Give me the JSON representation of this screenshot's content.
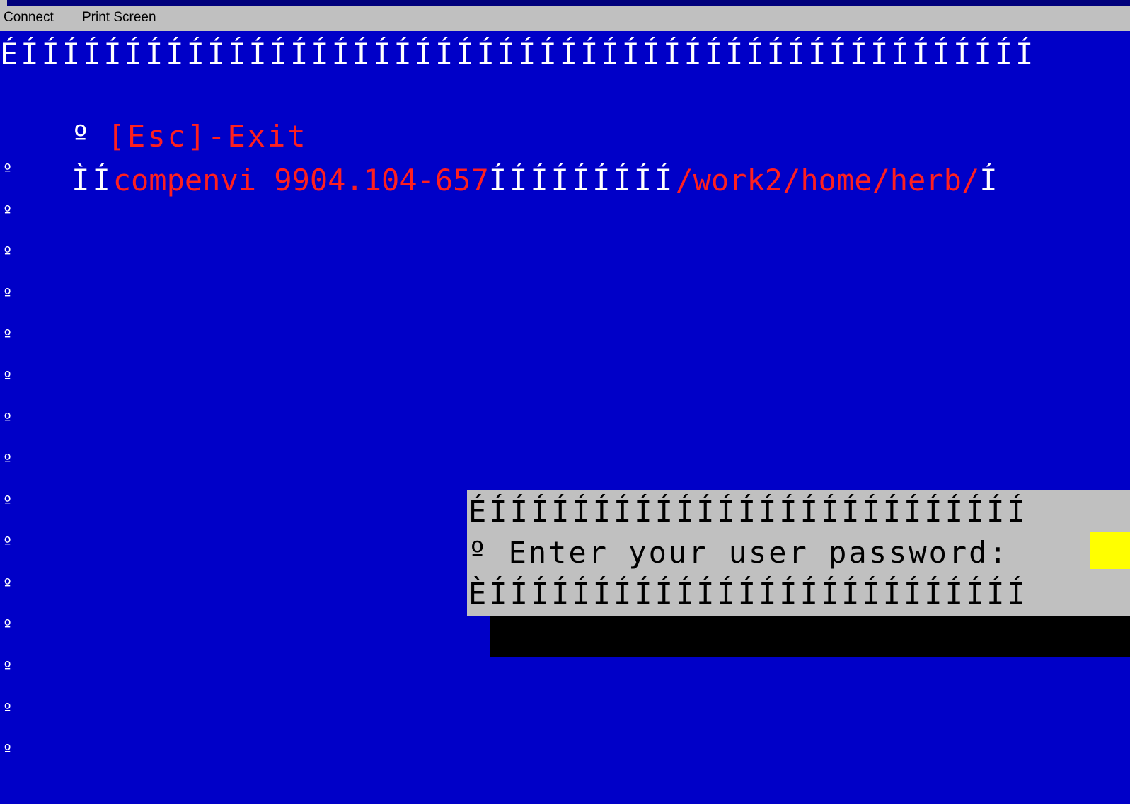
{
  "menu": {
    "connect": "Connect",
    "print_screen": "Print Screen"
  },
  "terminal": {
    "top_border": "ÉÍÍÍÍÍÍÍÍÍÍÍÍÍÍÍÍÍÍÍÍÍÍÍÍÍÍÍÍÍÍÍÍÍÍÍÍÍÍÍÍÍÍÍÍÍÍÍÍÍ",
    "esc_row": {
      "left_glyph": "º",
      "label": "[Esc]-Exit"
    },
    "status_row": {
      "lead": "ÌÍ",
      "version": "compenvi 9904.104-657",
      "fill": "ÍÍÍÍÍÍÍÍÍ",
      "path": "/work2/home/herb/",
      "tail": "Í"
    },
    "side_glyph": "º"
  },
  "dialog": {
    "top_border": "ÉÍÍÍÍÍÍÍÍÍÍÍÍÍÍÍÍÍÍÍÍÍÍÍÍÍÍ",
    "prompt_row": "º Enter your user password:",
    "bottom_border": "ÈÍÍÍÍÍÍÍÍÍÍÍÍÍÍÍÍÍÍÍÍÍÍÍÍÍÍ"
  },
  "colors": {
    "background": "#0000c8",
    "text": "#ffffff",
    "highlight": "#ff1f1f",
    "dialog": "#c0c0c0",
    "input_cursor": "#ffff00"
  }
}
